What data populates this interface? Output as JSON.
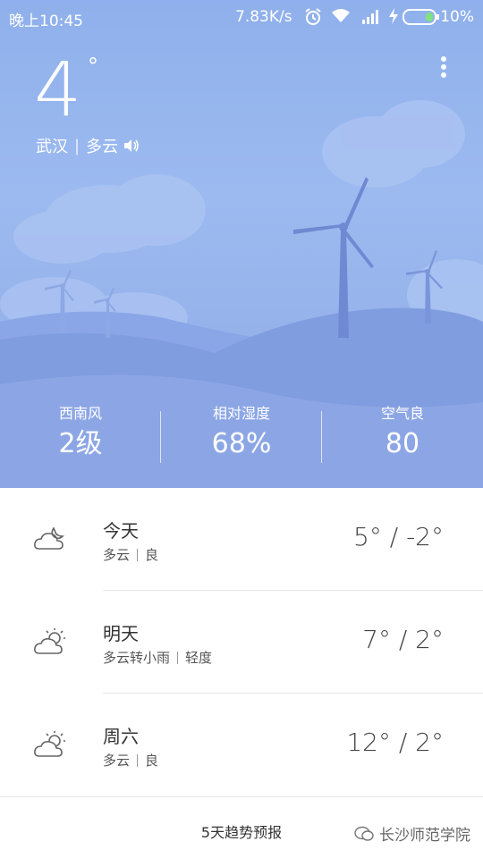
{
  "status_bar": {
    "time": "晚上10:45",
    "net_speed": "7.83K/s",
    "battery": "10%"
  },
  "current": {
    "temperature": "4",
    "degree_symbol": "°",
    "city": "武汉",
    "condition": "多云"
  },
  "stats": [
    {
      "label": "西南风",
      "value": "2级"
    },
    {
      "label": "相对湿度",
      "value": "68%"
    },
    {
      "label": "空气良",
      "value": "80"
    }
  ],
  "forecast": [
    {
      "day": "今天",
      "condition": "多云",
      "air": "良",
      "temp": "5° / -2°",
      "icon": "cloudy-night-icon"
    },
    {
      "day": "明天",
      "condition": "多云转小雨",
      "air": "轻度",
      "temp": "7° / 2°",
      "icon": "partly-cloudy-icon"
    },
    {
      "day": "周六",
      "condition": "多云",
      "air": "良",
      "temp": "12° / 2°",
      "icon": "partly-cloudy-icon"
    }
  ],
  "footer": {
    "trend_label": "5天趋势预报",
    "watermark": "长沙师范学院"
  },
  "colors": {
    "sky_top": "#8fb0ec",
    "sky_bottom": "#8ea9e4",
    "hill_dark": "#7f9be0",
    "turbine": "#6f89d2"
  }
}
